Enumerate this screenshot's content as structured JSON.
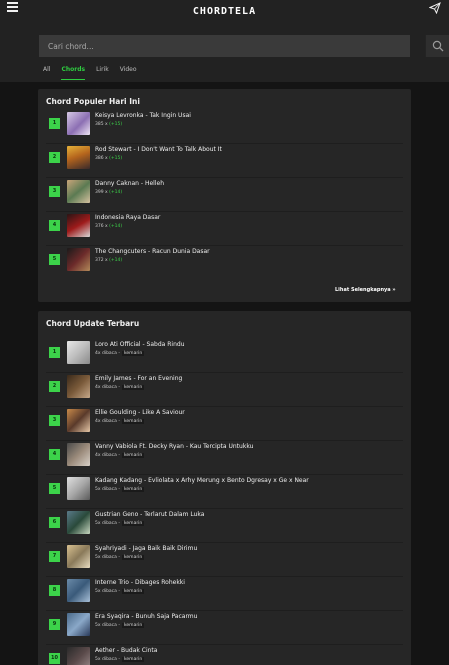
{
  "brand": {
    "name": "CHORDTELA"
  },
  "icons": {
    "menu": "hamburger-menu-icon",
    "send": "paper-plane-icon",
    "search": "magnifier-icon"
  },
  "search": {
    "placeholder": "Cari chord..."
  },
  "tabs": [
    {
      "label": "All",
      "active": false
    },
    {
      "label": "Chords",
      "active": true
    },
    {
      "label": "Lirik",
      "active": false
    },
    {
      "label": "Video",
      "active": false
    }
  ],
  "popular": {
    "title": "Chord Populer Hari Ini",
    "more_label": "Lihat Selengkapnya",
    "items": [
      {
        "rank": "1",
        "title": "Keisya Levronka - Tak Ingin Usai",
        "views": "385 x",
        "delta": "(+15)"
      },
      {
        "rank": "2",
        "title": "Rod Stewart - I Don't Want To Talk About It",
        "views": "386 x",
        "delta": "(+15)"
      },
      {
        "rank": "3",
        "title": "Danny Caknan - Helleh",
        "views": "399 x",
        "delta": "(+14)"
      },
      {
        "rank": "4",
        "title": "Indonesia Raya Dasar",
        "views": "376 x",
        "delta": "(+14)"
      },
      {
        "rank": "5",
        "title": "The Changcuters - Racun Dunia Dasar",
        "views": "372 x",
        "delta": "(+14)"
      }
    ]
  },
  "updates": {
    "title": "Chord Update Terbaru",
    "items": [
      {
        "rank": "1",
        "title": "Loro Ati Official - Sabda Rindu",
        "views": "4x dibaca -",
        "when": "kemarin"
      },
      {
        "rank": "2",
        "title": "Emily James - For an Evening",
        "views": "4x dibaca -",
        "when": "kemarin"
      },
      {
        "rank": "3",
        "title": "Ellie Goulding - Like A Saviour",
        "views": "4x dibaca -",
        "when": "kemarin"
      },
      {
        "rank": "4",
        "title": "Vanny Vabiola Ft. Decky Ryan - Kau Tercipta Untukku",
        "views": "4x dibaca -",
        "when": "kemarin"
      },
      {
        "rank": "5",
        "title": "Kadang Kadang - Evliolata x Arhy Merung x Bento Dgresay x Ge x Near",
        "views": "5x dibaca -",
        "when": "kemarin"
      },
      {
        "rank": "6",
        "title": "Gustrian Geno - Terlarut Dalam Luka",
        "views": "5x dibaca -",
        "when": "kemarin"
      },
      {
        "rank": "7",
        "title": "Syahriyadi - Jaga Baik Baik Dirimu",
        "views": "5x dibaca -",
        "when": "kemarin"
      },
      {
        "rank": "8",
        "title": "Interne Trio - Dibages Rohekki",
        "views": "5x dibaca -",
        "when": "kemarin"
      },
      {
        "rank": "9",
        "title": "Era Syaqira - Bunuh Saja Pacarmu",
        "views": "5x dibaca -",
        "when": "kemarin"
      },
      {
        "rank": "10",
        "title": "Aether - Budak Cinta",
        "views": "5x dibaca -",
        "when": "kemarin"
      }
    ]
  }
}
